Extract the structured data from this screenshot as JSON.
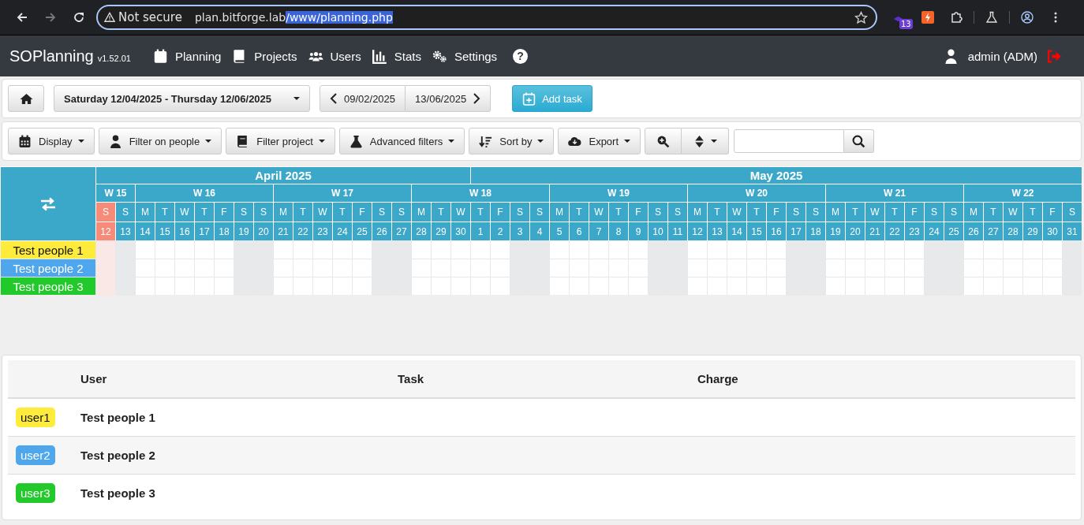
{
  "browser": {
    "forward": {
      "disabled": true
    },
    "security": "Not secure",
    "url_host": "plan.bitforge.lab",
    "url_path": "/www/planning.php",
    "url_path_selected": true,
    "extension_badge": "13"
  },
  "navbar": {
    "brand": "SOPlanning",
    "version": "v1.52.01",
    "items": [
      {
        "label": "Planning"
      },
      {
        "label": "Projects"
      },
      {
        "label": "Users"
      },
      {
        "label": "Stats"
      },
      {
        "label": "Settings"
      }
    ],
    "help": "?",
    "user": "admin (ADM)"
  },
  "toolbar": {
    "date_range": "Saturday 12/04/2025 - Thursday 12/06/2025",
    "start_date": "09/02/2025",
    "end_date": "13/06/2025",
    "add_task": "Add task"
  },
  "filters": [
    {
      "label": "Display"
    },
    {
      "label": "Filter on people"
    },
    {
      "label": "Filter project"
    },
    {
      "label": "Advanced filters"
    },
    {
      "label": "Sort by"
    },
    {
      "label": "Export"
    }
  ],
  "calendar": {
    "months": [
      {
        "label": "April 2025"
      },
      {
        "label": "May 2025"
      }
    ],
    "weeks": [
      {
        "label": "W 15",
        "days": [
          {
            "weekday": "S",
            "date": "12",
            "kind": "today"
          },
          {
            "weekday": "S",
            "date": "13",
            "kind": "weekend"
          }
        ]
      },
      {
        "label": "W 16",
        "days": [
          {
            "weekday": "M",
            "date": "14",
            "kind": "workday"
          },
          {
            "weekday": "T",
            "date": "15",
            "kind": "workday"
          },
          {
            "weekday": "W",
            "date": "16",
            "kind": "workday"
          },
          {
            "weekday": "T",
            "date": "17",
            "kind": "workday"
          },
          {
            "weekday": "F",
            "date": "18",
            "kind": "workday"
          },
          {
            "weekday": "S",
            "date": "19",
            "kind": "weekend"
          },
          {
            "weekday": "S",
            "date": "20",
            "kind": "weekend"
          }
        ]
      },
      {
        "label": "W 17",
        "days": [
          {
            "weekday": "M",
            "date": "21",
            "kind": "workday"
          },
          {
            "weekday": "T",
            "date": "22",
            "kind": "workday"
          },
          {
            "weekday": "W",
            "date": "23",
            "kind": "workday"
          },
          {
            "weekday": "T",
            "date": "24",
            "kind": "workday"
          },
          {
            "weekday": "F",
            "date": "25",
            "kind": "workday"
          },
          {
            "weekday": "S",
            "date": "26",
            "kind": "weekend"
          },
          {
            "weekday": "S",
            "date": "27",
            "kind": "weekend"
          }
        ]
      },
      {
        "label": "W 18",
        "days": [
          {
            "weekday": "M",
            "date": "28",
            "kind": "workday"
          },
          {
            "weekday": "T",
            "date": "29",
            "kind": "workday"
          },
          {
            "weekday": "W",
            "date": "30",
            "kind": "workday"
          },
          {
            "weekday": "T",
            "date": "1",
            "kind": "workday"
          },
          {
            "weekday": "F",
            "date": "2",
            "kind": "workday"
          },
          {
            "weekday": "S",
            "date": "3",
            "kind": "weekend"
          },
          {
            "weekday": "S",
            "date": "4",
            "kind": "weekend"
          }
        ]
      },
      {
        "label": "W 19",
        "days": [
          {
            "weekday": "M",
            "date": "5",
            "kind": "workday"
          },
          {
            "weekday": "T",
            "date": "6",
            "kind": "workday"
          },
          {
            "weekday": "W",
            "date": "7",
            "kind": "workday"
          },
          {
            "weekday": "T",
            "date": "8",
            "kind": "workday"
          },
          {
            "weekday": "F",
            "date": "9",
            "kind": "workday"
          },
          {
            "weekday": "S",
            "date": "10",
            "kind": "weekend"
          },
          {
            "weekday": "S",
            "date": "11",
            "kind": "weekend"
          }
        ]
      },
      {
        "label": "W 20",
        "days": [
          {
            "weekday": "M",
            "date": "12",
            "kind": "workday"
          },
          {
            "weekday": "T",
            "date": "13",
            "kind": "workday"
          },
          {
            "weekday": "W",
            "date": "14",
            "kind": "workday"
          },
          {
            "weekday": "T",
            "date": "15",
            "kind": "workday"
          },
          {
            "weekday": "F",
            "date": "16",
            "kind": "workday"
          },
          {
            "weekday": "S",
            "date": "17",
            "kind": "weekend"
          },
          {
            "weekday": "S",
            "date": "18",
            "kind": "weekend"
          }
        ]
      },
      {
        "label": "W 21",
        "days": [
          {
            "weekday": "M",
            "date": "19",
            "kind": "workday"
          },
          {
            "weekday": "T",
            "date": "20",
            "kind": "workday"
          },
          {
            "weekday": "W",
            "date": "21",
            "kind": "workday"
          },
          {
            "weekday": "T",
            "date": "22",
            "kind": "workday"
          },
          {
            "weekday": "F",
            "date": "23",
            "kind": "workday"
          },
          {
            "weekday": "S",
            "date": "24",
            "kind": "weekend"
          },
          {
            "weekday": "S",
            "date": "25",
            "kind": "weekend"
          }
        ]
      },
      {
        "label": "W 22",
        "days": [
          {
            "weekday": "M",
            "date": "26",
            "kind": "workday"
          },
          {
            "weekday": "T",
            "date": "27",
            "kind": "workday"
          },
          {
            "weekday": "W",
            "date": "28",
            "kind": "workday"
          },
          {
            "weekday": "T",
            "date": "29",
            "kind": "workday"
          },
          {
            "weekday": "F",
            "date": "30",
            "kind": "workday"
          },
          {
            "weekday": "S",
            "date": "31",
            "kind": "weekend"
          }
        ]
      }
    ],
    "people": [
      {
        "name": "Test people 1",
        "color": "#ffeb3b"
      },
      {
        "name": "Test people 2",
        "color": "#4ea7ec"
      },
      {
        "name": "Test people 3",
        "color": "#22c92a"
      }
    ]
  },
  "table": {
    "columns": [
      "User",
      "Task",
      "Charge"
    ],
    "rows": [
      {
        "badge": "user1",
        "color": "#ffeb3b",
        "user": "Test people 1"
      },
      {
        "badge": "user2",
        "color": "#4ea7ec",
        "user": "Test people 2"
      },
      {
        "badge": "user3",
        "color": "#22c92a",
        "user": "Test people 3"
      }
    ]
  }
}
